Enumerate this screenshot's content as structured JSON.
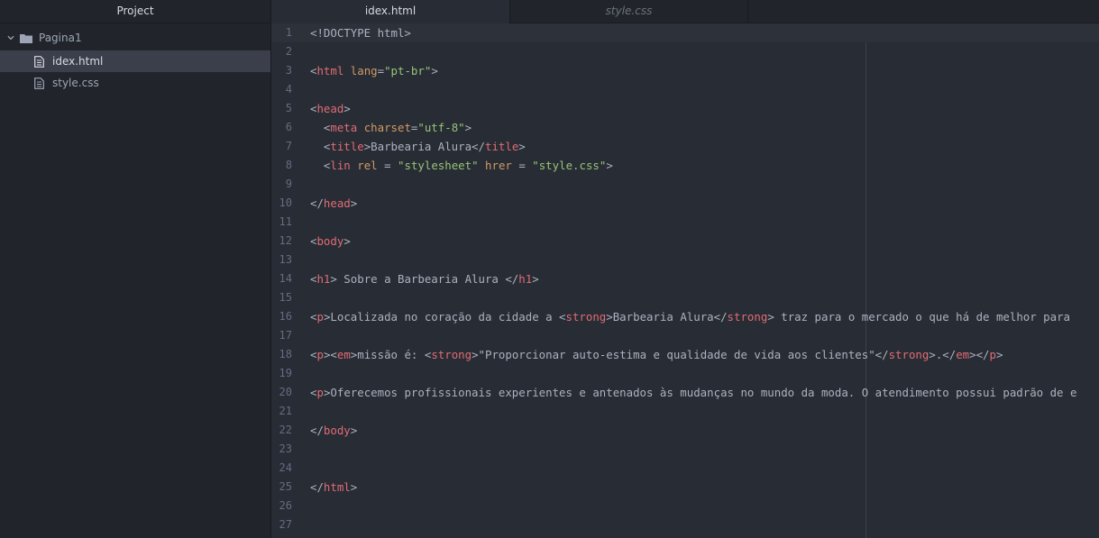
{
  "sidebar": {
    "title": "Project",
    "folder": "Pagina1",
    "files": [
      "idex.html",
      "style.css"
    ]
  },
  "tabs": [
    {
      "label": "idex.html",
      "active": true
    },
    {
      "label": "style.css",
      "active": false
    }
  ],
  "colors": {
    "tag": "#e06c75",
    "attribute": "#d19a66",
    "string": "#98c379",
    "text": "#abb2bf",
    "gutter": "#636d83"
  },
  "editor": {
    "cursor_line": 1,
    "lines": [
      [
        [
          "p",
          "<!DOCTYPE html>"
        ]
      ],
      [],
      [
        [
          "p",
          "<"
        ],
        [
          "t",
          "html"
        ],
        [
          "p",
          " "
        ],
        [
          "a",
          "lang"
        ],
        [
          "p",
          "="
        ],
        [
          "s",
          "\"pt-br\""
        ],
        [
          "p",
          ">"
        ]
      ],
      [],
      [
        [
          "p",
          "<"
        ],
        [
          "t",
          "head"
        ],
        [
          "p",
          ">"
        ]
      ],
      [
        [
          "p",
          "  <"
        ],
        [
          "t",
          "meta"
        ],
        [
          "p",
          " "
        ],
        [
          "a",
          "charset"
        ],
        [
          "p",
          "="
        ],
        [
          "s",
          "\"utf-8\""
        ],
        [
          "p",
          ">"
        ]
      ],
      [
        [
          "p",
          "  <"
        ],
        [
          "t",
          "title"
        ],
        [
          "p",
          ">Barbearia Alura</"
        ],
        [
          "t",
          "title"
        ],
        [
          "p",
          ">"
        ]
      ],
      [
        [
          "p",
          "  <"
        ],
        [
          "t",
          "lin"
        ],
        [
          "p",
          " "
        ],
        [
          "a",
          "rel"
        ],
        [
          "p",
          " = "
        ],
        [
          "s",
          "\"stylesheet\""
        ],
        [
          "p",
          " "
        ],
        [
          "a",
          "hrer"
        ],
        [
          "p",
          " = "
        ],
        [
          "s",
          "\"style.css\""
        ],
        [
          "p",
          ">"
        ]
      ],
      [],
      [
        [
          "p",
          "</"
        ],
        [
          "t",
          "head"
        ],
        [
          "p",
          ">"
        ]
      ],
      [],
      [
        [
          "p",
          "<"
        ],
        [
          "t",
          "body"
        ],
        [
          "p",
          ">"
        ]
      ],
      [],
      [
        [
          "p",
          "<"
        ],
        [
          "t",
          "h1"
        ],
        [
          "p",
          "> Sobre a Barbearia Alura </"
        ],
        [
          "t",
          "h1"
        ],
        [
          "p",
          ">"
        ]
      ],
      [],
      [
        [
          "p",
          "<"
        ],
        [
          "t",
          "p"
        ],
        [
          "p",
          ">Localizada no coração da cidade a <"
        ],
        [
          "t",
          "strong"
        ],
        [
          "p",
          ">Barbearia Alura</"
        ],
        [
          "t",
          "strong"
        ],
        [
          "p",
          "> traz para o mercado o que há de melhor para"
        ]
      ],
      [],
      [
        [
          "p",
          "<"
        ],
        [
          "t",
          "p"
        ],
        [
          "p",
          "><"
        ],
        [
          "t",
          "em"
        ],
        [
          "p",
          ">missão é: <"
        ],
        [
          "t",
          "strong"
        ],
        [
          "p",
          ">\"Proporcionar auto-estima e qualidade de vida aos clientes\"</"
        ],
        [
          "t",
          "strong"
        ],
        [
          "p",
          ">.</"
        ],
        [
          "t",
          "em"
        ],
        [
          "p",
          "></"
        ],
        [
          "t",
          "p"
        ],
        [
          "p",
          ">"
        ]
      ],
      [],
      [
        [
          "p",
          "<"
        ],
        [
          "t",
          "p"
        ],
        [
          "p",
          ">Oferecemos profissionais experientes e antenados às mudanças no mundo da moda. O atendimento possui padrão de e"
        ]
      ],
      [],
      [
        [
          "p",
          "</"
        ],
        [
          "t",
          "body"
        ],
        [
          "p",
          ">"
        ]
      ],
      [],
      [],
      [
        [
          "p",
          "</"
        ],
        [
          "t",
          "html"
        ],
        [
          "p",
          ">"
        ]
      ],
      [],
      []
    ]
  }
}
